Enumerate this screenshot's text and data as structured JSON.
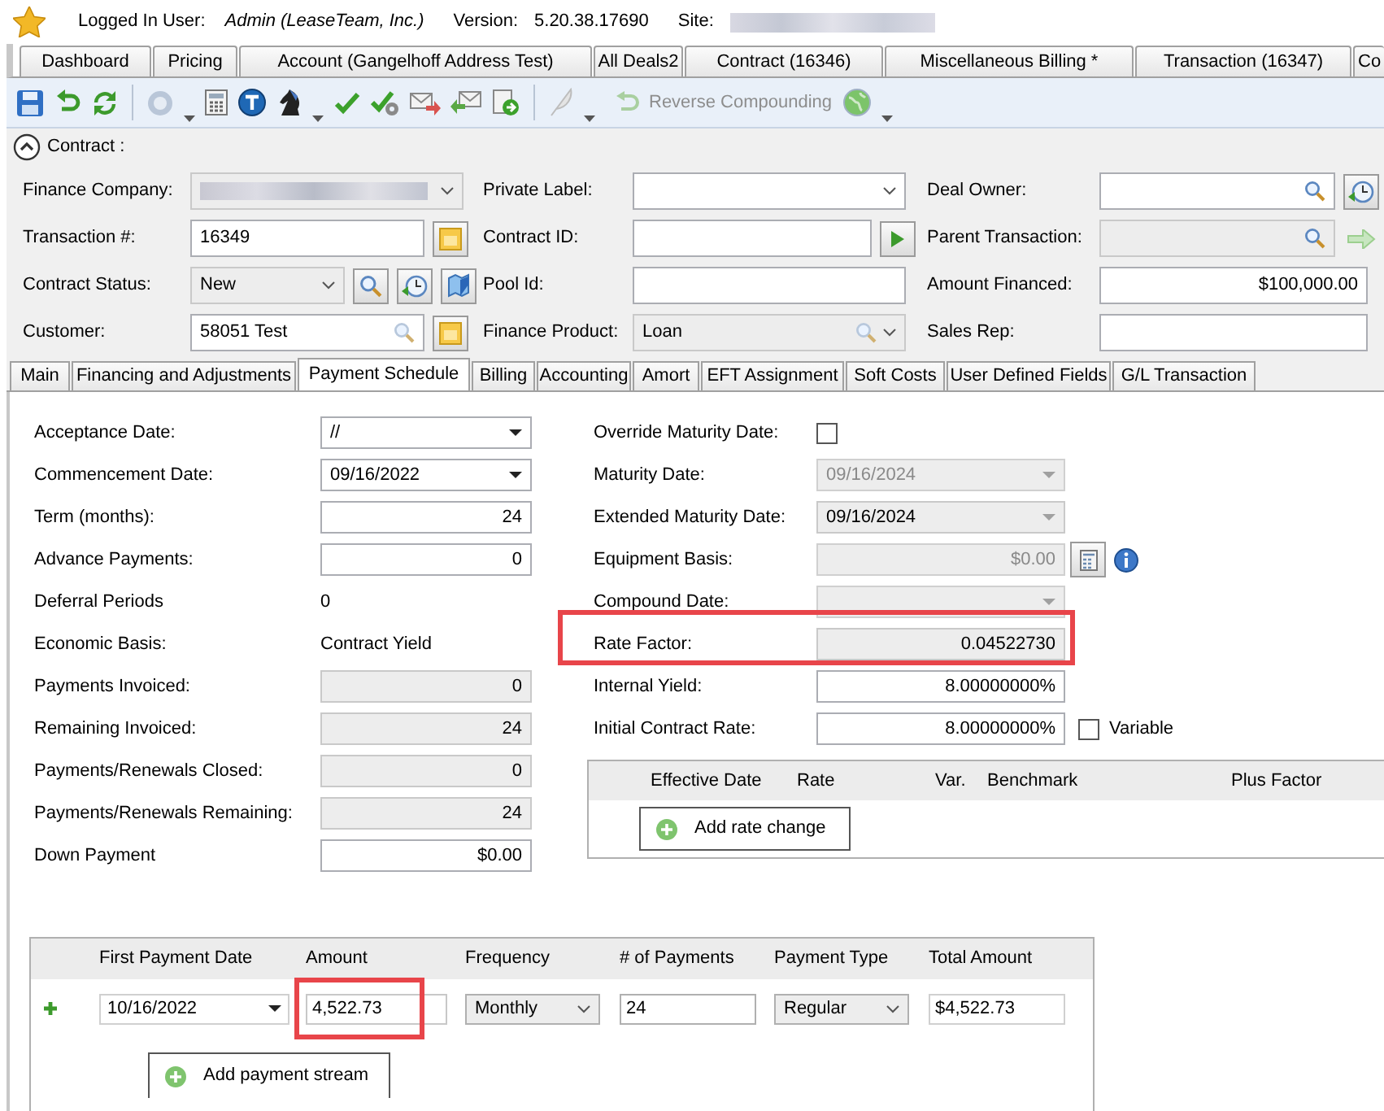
{
  "header": {
    "user_label": "Logged In User:",
    "user": "Admin (LeaseTeam, Inc.)",
    "version_label": "Version:",
    "version": "5.20.38.17690",
    "site_label": "Site:"
  },
  "tabs": [
    {
      "label": "Dashboard",
      "selected": false
    },
    {
      "label": "Pricing",
      "selected": false
    },
    {
      "label": "Account (Gangelhoff Address Test)",
      "selected": false
    },
    {
      "label": "All Deals2",
      "selected": false
    },
    {
      "label": "Contract (16346)",
      "selected": false
    },
    {
      "label": "Miscellaneous Billing *",
      "selected": false
    },
    {
      "label": "Transaction (16347)",
      "selected": false
    },
    {
      "label": "Co",
      "selected": false
    }
  ],
  "toolbar": {
    "reverse_compounding": {
      "label": "Reverse Compounding",
      "disabled": true
    }
  },
  "contract": {
    "title": "Contract :",
    "expanded": true,
    "fields": [
      {
        "label": "Finance Company:",
        "kind": "blurred_select",
        "readonly": true,
        "disabled": false
      },
      {
        "label": "Private Label:",
        "kind": "select",
        "readonly": false,
        "disabled": false
      },
      {
        "label": "Deal Owner:",
        "kind": "lookup",
        "readonly": false,
        "disabled": false
      },
      {
        "label": "Transaction #:",
        "kind": "text",
        "readonly": false,
        "disabled": false,
        "value": "16349"
      },
      {
        "label": "Contract ID:",
        "kind": "text",
        "readonly": false,
        "disabled": false
      },
      {
        "label": "Parent Transaction:",
        "kind": "lookup",
        "readonly": true,
        "disabled": false
      },
      {
        "label": "Contract Status:",
        "kind": "select",
        "readonly": true,
        "disabled": false,
        "value": "New"
      },
      {
        "label": "Pool Id:",
        "kind": "text",
        "readonly": false,
        "disabled": false
      },
      {
        "label": "Amount Financed:",
        "kind": "number",
        "readonly": false,
        "disabled": false,
        "value": "$100,000.00"
      },
      {
        "label": "Customer:",
        "kind": "lookup",
        "readonly": false,
        "disabled": false,
        "value": "58051 Test"
      },
      {
        "label": "Finance Product:",
        "kind": "lookup_select",
        "readonly": true,
        "disabled": false,
        "value": "Loan"
      },
      {
        "label": "Sales Rep:",
        "kind": "text",
        "readonly": false,
        "disabled": false
      }
    ]
  },
  "subtabs": [
    {
      "label": "Main",
      "selected": false
    },
    {
      "label": "Financing and Adjustments",
      "selected": false
    },
    {
      "label": "Payment Schedule",
      "selected": true
    },
    {
      "label": "Billing",
      "selected": false
    },
    {
      "label": "Accounting",
      "selected": false
    },
    {
      "label": "Amort",
      "selected": false
    },
    {
      "label": "EFT Assignment",
      "selected": false
    },
    {
      "label": "Soft Costs",
      "selected": false
    },
    {
      "label": "User Defined Fields",
      "selected": false
    },
    {
      "label": "G/L Transaction",
      "selected": false
    }
  ],
  "schedule_left": [
    {
      "label": "Acceptance Date:",
      "kind": "date",
      "readonly": false,
      "disabled": false,
      "value": "//"
    },
    {
      "label": "Commencement Date:",
      "kind": "date",
      "readonly": false,
      "disabled": false,
      "value": "09/16/2022"
    },
    {
      "label": "Term (months):",
      "kind": "number",
      "readonly": false,
      "disabled": false,
      "value": "24"
    },
    {
      "label": "Advance Payments:",
      "kind": "number",
      "readonly": false,
      "disabled": false,
      "value": "0"
    },
    {
      "label": "Deferral Periods",
      "kind": "static",
      "value": "0"
    },
    {
      "label": "Economic Basis:",
      "kind": "static",
      "value": "Contract Yield"
    },
    {
      "label": "Payments Invoiced:",
      "kind": "number",
      "readonly": true,
      "disabled": false,
      "value": "0"
    },
    {
      "label": "Remaining Invoiced:",
      "kind": "number",
      "readonly": true,
      "disabled": false,
      "value": "24"
    },
    {
      "label": "Payments/Renewals Closed:",
      "kind": "number",
      "readonly": true,
      "disabled": false,
      "value": "0"
    },
    {
      "label": "Payments/Renewals Remaining:",
      "kind": "number",
      "readonly": true,
      "disabled": false,
      "value": "24"
    },
    {
      "label": "Down Payment",
      "kind": "number",
      "readonly": false,
      "disabled": false,
      "value": "$0.00"
    }
  ],
  "schedule_right": [
    {
      "label": "Override Maturity Date:",
      "kind": "checkbox",
      "checked": false,
      "highlighted": false
    },
    {
      "label": "Maturity Date:",
      "kind": "date",
      "readonly": true,
      "disabled": true,
      "value": "09/16/2024",
      "highlighted": false
    },
    {
      "label": "Extended Maturity Date:",
      "kind": "date",
      "readonly": true,
      "disabled": false,
      "value": "09/16/2024",
      "highlighted": false
    },
    {
      "label": "Equipment Basis:",
      "kind": "number",
      "readonly": true,
      "disabled": true,
      "value": "$0.00",
      "highlighted": false
    },
    {
      "label": "Compound Date:",
      "kind": "date",
      "readonly": true,
      "disabled": true,
      "highlighted": false
    },
    {
      "label": "Rate Factor:",
      "kind": "number",
      "readonly": true,
      "disabled": false,
      "value": "0.04522730",
      "highlighted": true
    },
    {
      "label": "Internal Yield:",
      "kind": "number",
      "readonly": false,
      "disabled": false,
      "value": "8.00000000%",
      "highlighted": false
    },
    {
      "label": "Initial Contract Rate:",
      "kind": "number",
      "readonly": false,
      "disabled": false,
      "value": "8.00000000%",
      "highlighted": false,
      "option": {
        "label": "Variable",
        "checked": false
      }
    }
  ],
  "rate_table": {
    "columns": [
      "Effective Date",
      "Rate",
      "Var.",
      "Benchmark",
      "Plus Factor"
    ],
    "button": "Add rate change"
  },
  "payment_streams": {
    "columns": [
      "First Payment Date",
      "Amount",
      "Frequency",
      "# of Payments",
      "Payment Type",
      "Total Amount"
    ],
    "rows": [
      {
        "first_payment_date": "10/16/2022",
        "amount": "4,522.73",
        "amount_highlighted": true,
        "frequency": "Monthly",
        "payments": "24",
        "payment_type": "Regular",
        "total_amount": "$4,522.73"
      }
    ],
    "button": "Add payment stream"
  }
}
